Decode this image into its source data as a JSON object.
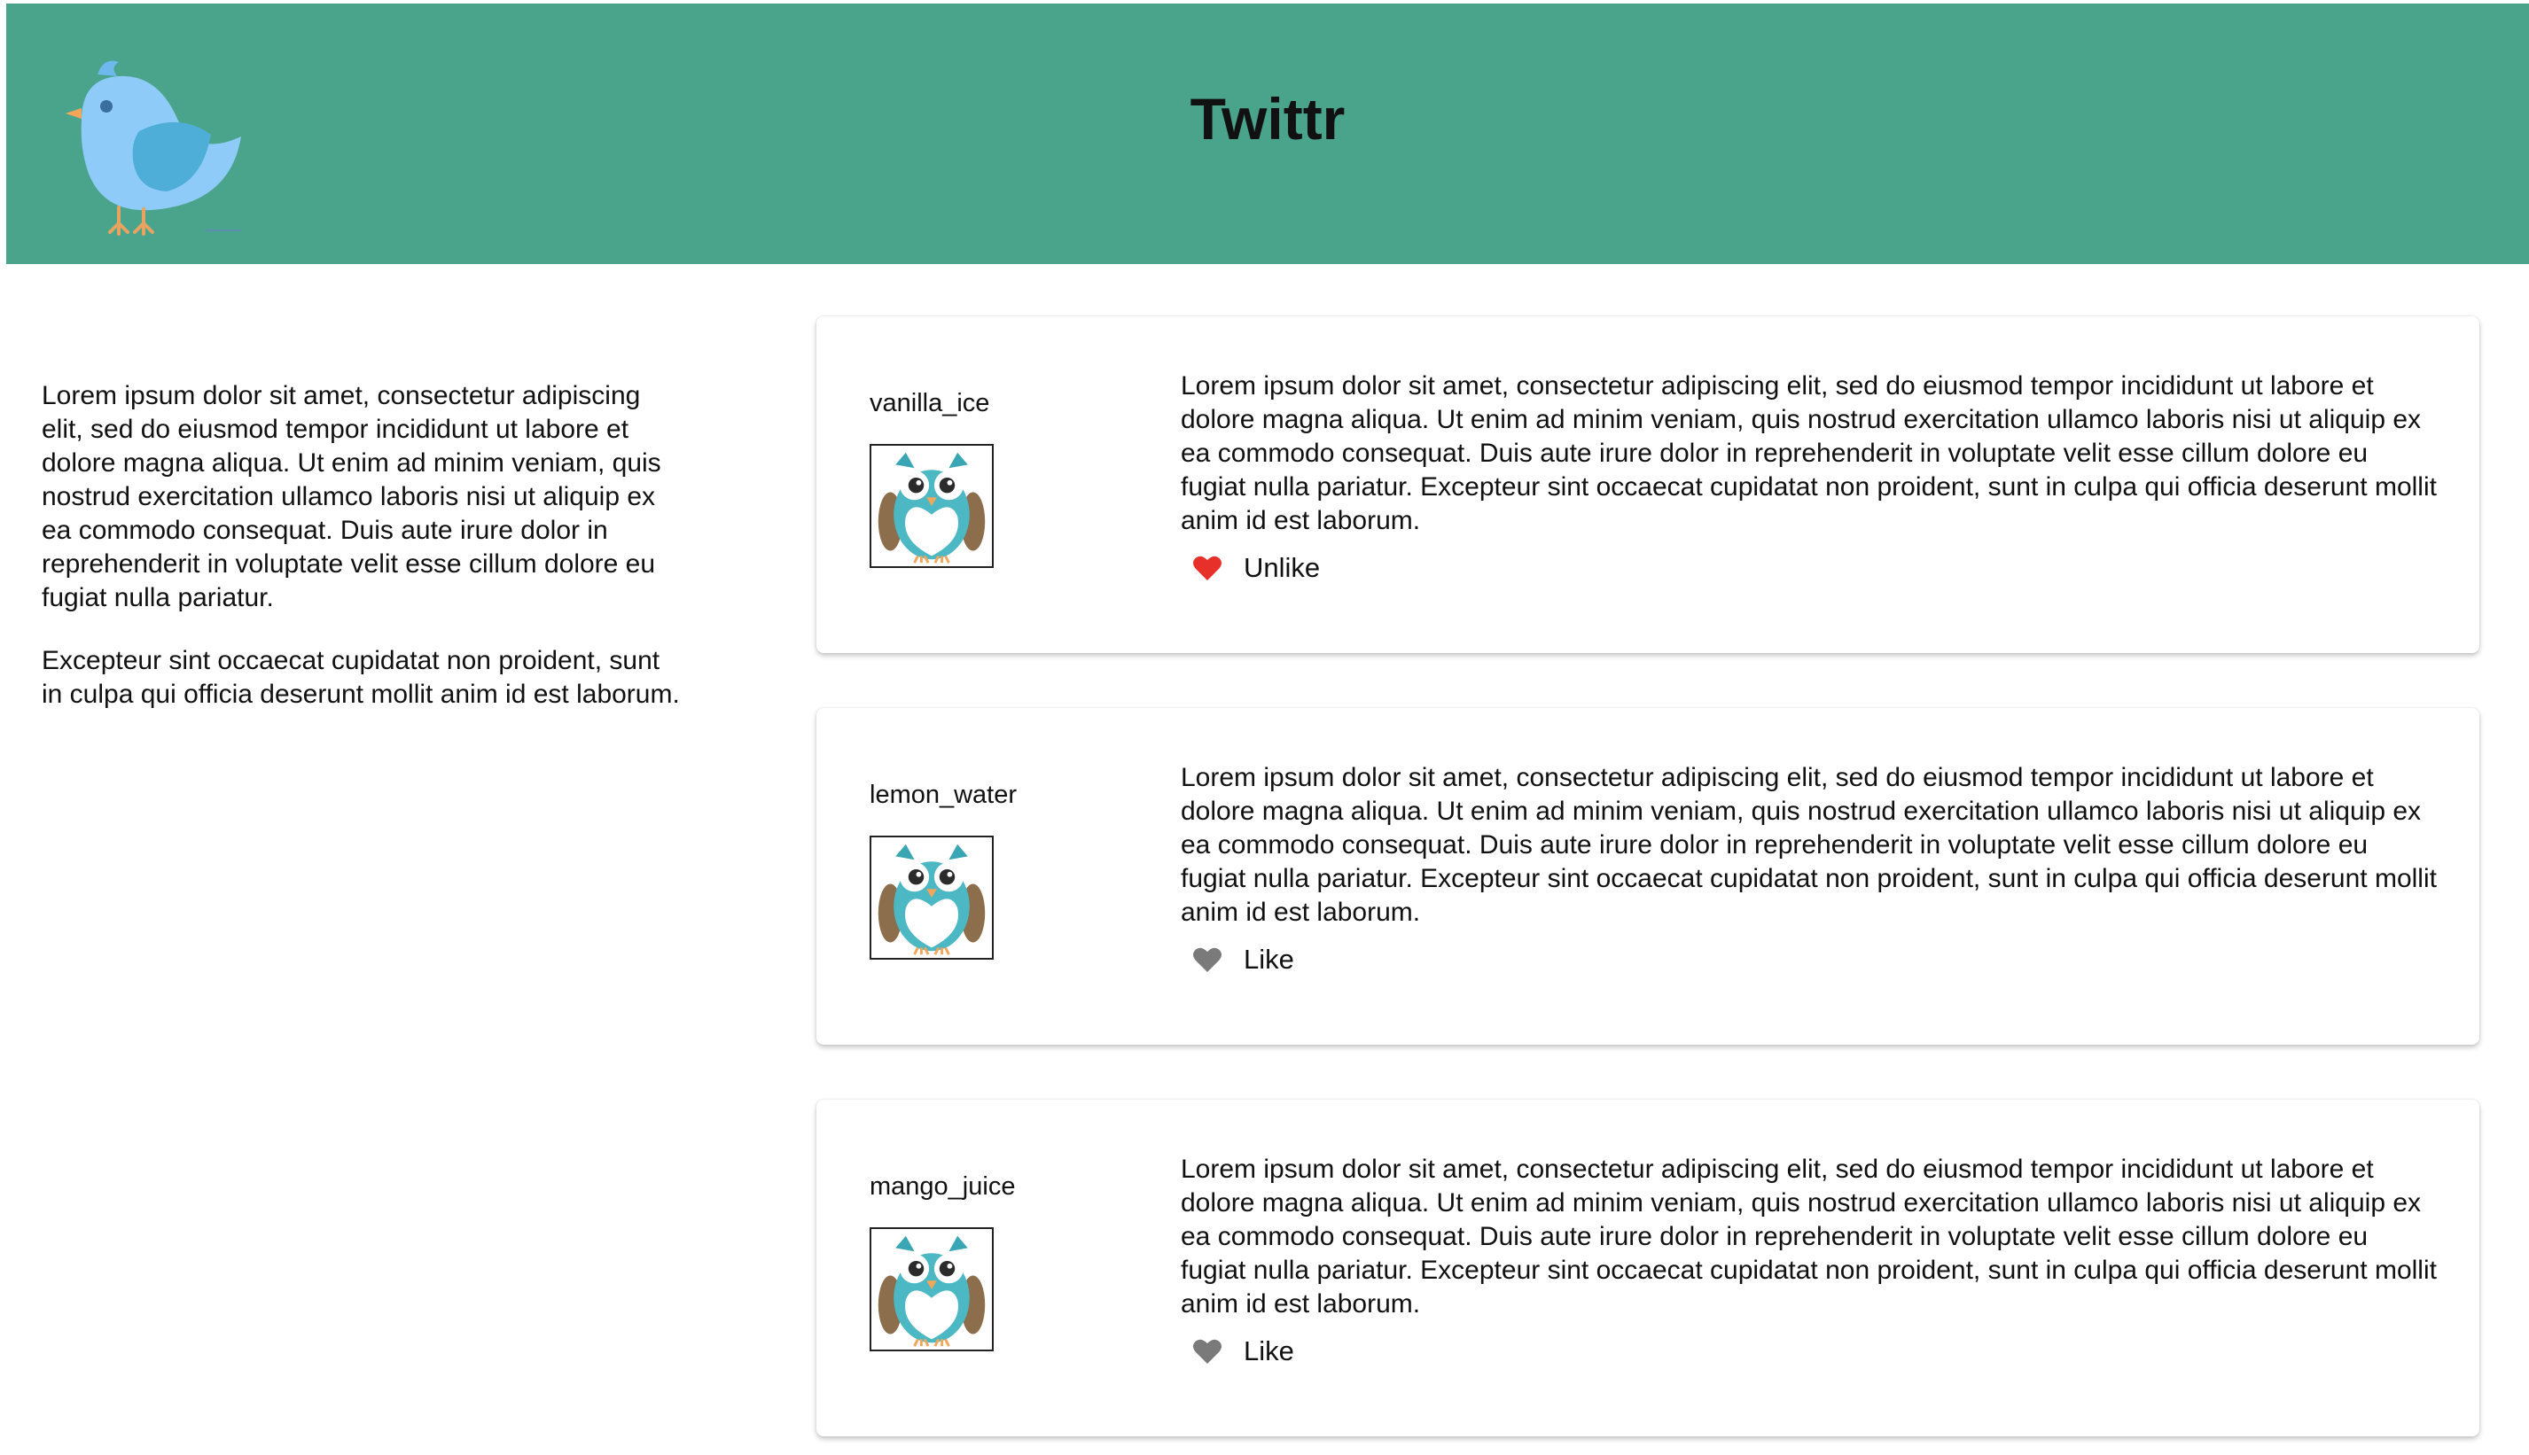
{
  "app": {
    "title": "Twittr",
    "logo_icon": "bird-logo-icon"
  },
  "sidebar": {
    "paragraphs": [
      "Lorem ipsum dolor sit amet, consectetur adipiscing elit, sed do eiusmod tempor incididunt ut labore et dolore magna aliqua. Ut enim ad minim veniam, quis nostrud exercitation ullamco laboris nisi ut aliquip ex ea commodo consequat. Duis aute irure dolor in reprehenderit in voluptate velit esse cillum dolore eu fugiat nulla pariatur.",
      "Excepteur sint occaecat cupidatat non proident, sunt in culpa qui officia deserunt mollit anim id est laborum."
    ]
  },
  "posts": [
    {
      "username": "vanilla_ice",
      "avatar_icon": "owl-avatar-icon",
      "text": "Lorem ipsum dolor sit amet, consectetur adipiscing elit, sed do eiusmod tempor incididunt ut labore et dolore magna aliqua. Ut enim ad minim veniam, quis nostrud exercitation ullamco laboris nisi ut aliquip ex ea commodo consequat. Duis aute irure dolor in reprehenderit in voluptate velit esse cillum dolore eu fugiat nulla pariatur. Excepteur sint occaecat cupidatat non proident, sunt in culpa qui officia deserunt mollit anim id est laborum.",
      "like_label": "Unlike",
      "liked": true,
      "heart_color": "#e8302a"
    },
    {
      "username": "lemon_water",
      "avatar_icon": "owl-avatar-icon",
      "text": "Lorem ipsum dolor sit amet, consectetur adipiscing elit, sed do eiusmod tempor incididunt ut labore et dolore magna aliqua. Ut enim ad minim veniam, quis nostrud exercitation ullamco laboris nisi ut aliquip ex ea commodo consequat. Duis aute irure dolor in reprehenderit in voluptate velit esse cillum dolore eu fugiat nulla pariatur. Excepteur sint occaecat cupidatat non proident, sunt in culpa qui officia deserunt mollit anim id est laborum.",
      "like_label": "Like",
      "liked": false,
      "heart_color": "#7a7a7a"
    },
    {
      "username": "mango_juice",
      "avatar_icon": "owl-avatar-icon",
      "text": "Lorem ipsum dolor sit amet, consectetur adipiscing elit, sed do eiusmod tempor incididunt ut labore et dolore magna aliqua. Ut enim ad minim veniam, quis nostrud exercitation ullamco laboris nisi ut aliquip ex ea commodo consequat. Duis aute irure dolor in reprehenderit in voluptate velit esse cillum dolore eu fugiat nulla pariatur. Excepteur sint occaecat cupidatat non proident, sunt in culpa qui officia deserunt mollit anim id est laborum.",
      "like_label": "Like",
      "liked": false,
      "heart_color": "#7a7a7a"
    }
  ],
  "colors": {
    "header_bg": "#4aa48b",
    "liked_heart": "#e8302a",
    "unliked_heart": "#7a7a7a"
  }
}
